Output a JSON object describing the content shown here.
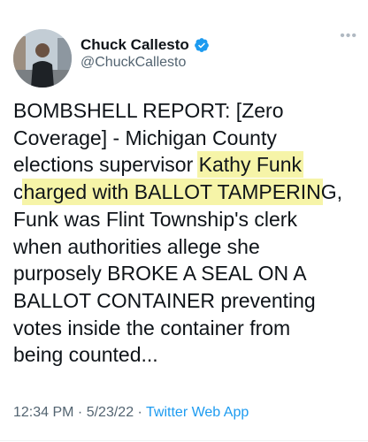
{
  "tweet": {
    "author": {
      "display_name": "Chuck Callesto",
      "handle": "@ChuckCallesto",
      "verified": true,
      "avatar_icon": "profile-photo"
    },
    "more_icon": "more-dots-icon",
    "text_before": "BOMBSHELL REPORT: [Zero\nCoverage] - Michigan County\nelections supervisor ",
    "text_highlight_1": "Kathy Funk",
    "text_between": "\nc",
    "text_highlight_2": "harged with BALLOT TAMPERIN",
    "text_after": "G,\nFunk was Flint Township's clerk\nwhen authorities allege she\npurposely BROKE A SEAL ON A\nBALLOT CONTAINER preventing\nvotes inside the container from\nbeing counted...",
    "time": "12:34 PM",
    "date": "5/23/22",
    "separator": " · ",
    "source": "Twitter Web App"
  },
  "colors": {
    "highlight": "#f6f4a8",
    "verified_blue": "#1d9bf0",
    "muted_text": "#536471"
  }
}
